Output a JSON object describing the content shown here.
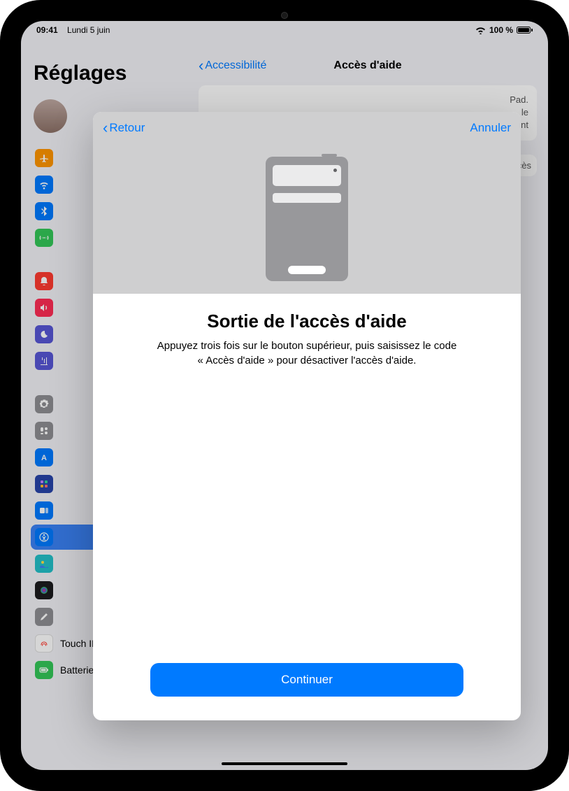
{
  "status": {
    "time": "09:41",
    "date": "Lundi 5 juin",
    "battery_pct": "100 %"
  },
  "bg": {
    "settings_title": "Réglages",
    "nav_back": "Accessibilité",
    "nav_title": "Accès d'aide",
    "card1_tail": "Pad.\nle\nent",
    "card2_tail": "cès",
    "items": {
      "touchid": "Touch ID et code",
      "battery": "Batterie"
    }
  },
  "sheet": {
    "back_label": "Retour",
    "cancel_label": "Annuler",
    "title": "Sortie de l'accès d'aide",
    "description": "Appuyez trois fois sur le bouton supérieur, puis saisissez le code « Accès d'aide » pour désactiver l'accès d'aide.",
    "continue_label": "Continuer"
  },
  "colors": {
    "airplane": "#ff9500",
    "wifi": "#007aff",
    "bluetooth": "#007aff",
    "cellular": "#34c759",
    "notif": "#ff3b30",
    "sound": "#ff2d55",
    "focus": "#5856d6",
    "screentime": "#5856d6",
    "general": "#8e8e93",
    "control": "#8e8e93",
    "display": "#007aff",
    "home": "#2845aa",
    "access": "#007aff",
    "wallpaper": "#23c0c9",
    "siri": "#1c1c1e",
    "pencil": "#8e8e93",
    "touchid": "#ff3b30",
    "battery": "#34c759"
  }
}
